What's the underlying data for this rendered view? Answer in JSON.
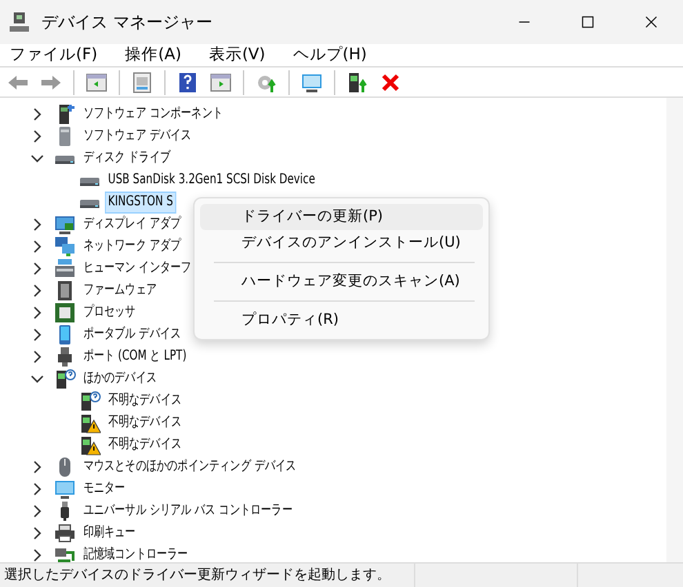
{
  "window": {
    "title": "デバイス マネージャー"
  },
  "menu_bar": [
    "ファイル(F)",
    "操作(A)",
    "表示(V)",
    "ヘルプ(H)"
  ],
  "tree": [
    {
      "label": "ソフトウェア コンポーネント",
      "expanded": false,
      "selected": false
    },
    {
      "label": "ソフトウェア デバイス",
      "expanded": false,
      "selected": false
    },
    {
      "label": "ディスク ドライブ",
      "expanded": true,
      "selected": false,
      "children": [
        {
          "label": "USB  SanDisk 3.2Gen1 SCSI Disk Device",
          "selected": false
        },
        {
          "label": "KINGSTON S",
          "selected": true
        }
      ]
    },
    {
      "label": "ディスプレイ アダプ",
      "expanded": false,
      "selected": false
    },
    {
      "label": "ネットワーク アダプ",
      "expanded": false,
      "selected": false
    },
    {
      "label": "ヒューマン インターフ",
      "expanded": false,
      "selected": false
    },
    {
      "label": "ファームウェア",
      "expanded": false,
      "selected": false
    },
    {
      "label": "プロセッサ",
      "expanded": false,
      "selected": false
    },
    {
      "label": "ポータブル デバイス",
      "expanded": false,
      "selected": false
    },
    {
      "label": "ポート (COM と LPT)",
      "expanded": false,
      "selected": false
    },
    {
      "label": "ほかのデバイス",
      "expanded": true,
      "selected": false,
      "children": [
        {
          "label": "不明なデバイス",
          "selected": false,
          "warning": false
        },
        {
          "label": "不明なデバイス",
          "selected": false,
          "warning": true
        },
        {
          "label": "不明なデバイス",
          "selected": false,
          "warning": true
        }
      ]
    },
    {
      "label": "マウスとそのほかのポインティング デバイス",
      "expanded": false,
      "selected": false
    },
    {
      "label": "モニター",
      "expanded": false,
      "selected": false
    },
    {
      "label": "ユニバーサル シリアル バス コントローラー",
      "expanded": false,
      "selected": false
    },
    {
      "label": "印刷キュー",
      "expanded": false,
      "selected": false
    },
    {
      "label": "記憶域コントローラー",
      "expanded": false,
      "selected": false
    }
  ],
  "context_menu": [
    {
      "kind": "item",
      "label": "ドライバーの更新(P)",
      "selected": true
    },
    {
      "kind": "item",
      "label": "デバイスのアンインストール(U)",
      "selected": false
    },
    {
      "kind": "separator"
    },
    {
      "kind": "item",
      "label": "ハードウェア変更のスキャン(A)",
      "selected": false
    },
    {
      "kind": "separator"
    },
    {
      "kind": "item",
      "label": "プロパティ(R)",
      "selected": false
    }
  ],
  "status_bar": "選択したデバイスのドライバー更新ウィザードを起動します。"
}
